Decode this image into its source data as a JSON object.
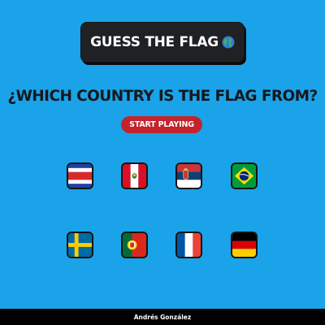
{
  "header": {
    "title": "GUESS THE FLAG",
    "title_icon": "globe-icon"
  },
  "main": {
    "question": "¿WHICH COUNTRY IS THE FLAG FROM?",
    "start_button": "START PLAYING"
  },
  "flags": [
    {
      "country": "Costa Rica",
      "icon": "costa-rica-flag-icon"
    },
    {
      "country": "Peru",
      "icon": "peru-flag-icon"
    },
    {
      "country": "Serbia",
      "icon": "serbia-flag-icon"
    },
    {
      "country": "Brazil",
      "icon": "brazil-flag-icon"
    },
    {
      "country": "Sweden",
      "icon": "sweden-flag-icon"
    },
    {
      "country": "Portugal",
      "icon": "portugal-flag-icon"
    },
    {
      "country": "France",
      "icon": "france-flag-icon"
    },
    {
      "country": "Germany",
      "icon": "germany-flag-icon"
    }
  ],
  "footer": {
    "author": "Andrés González"
  },
  "colors": {
    "background": "#1aa3e8",
    "title_button": "#1f2125",
    "start_button": "#c3232b",
    "footer": "#000000"
  }
}
